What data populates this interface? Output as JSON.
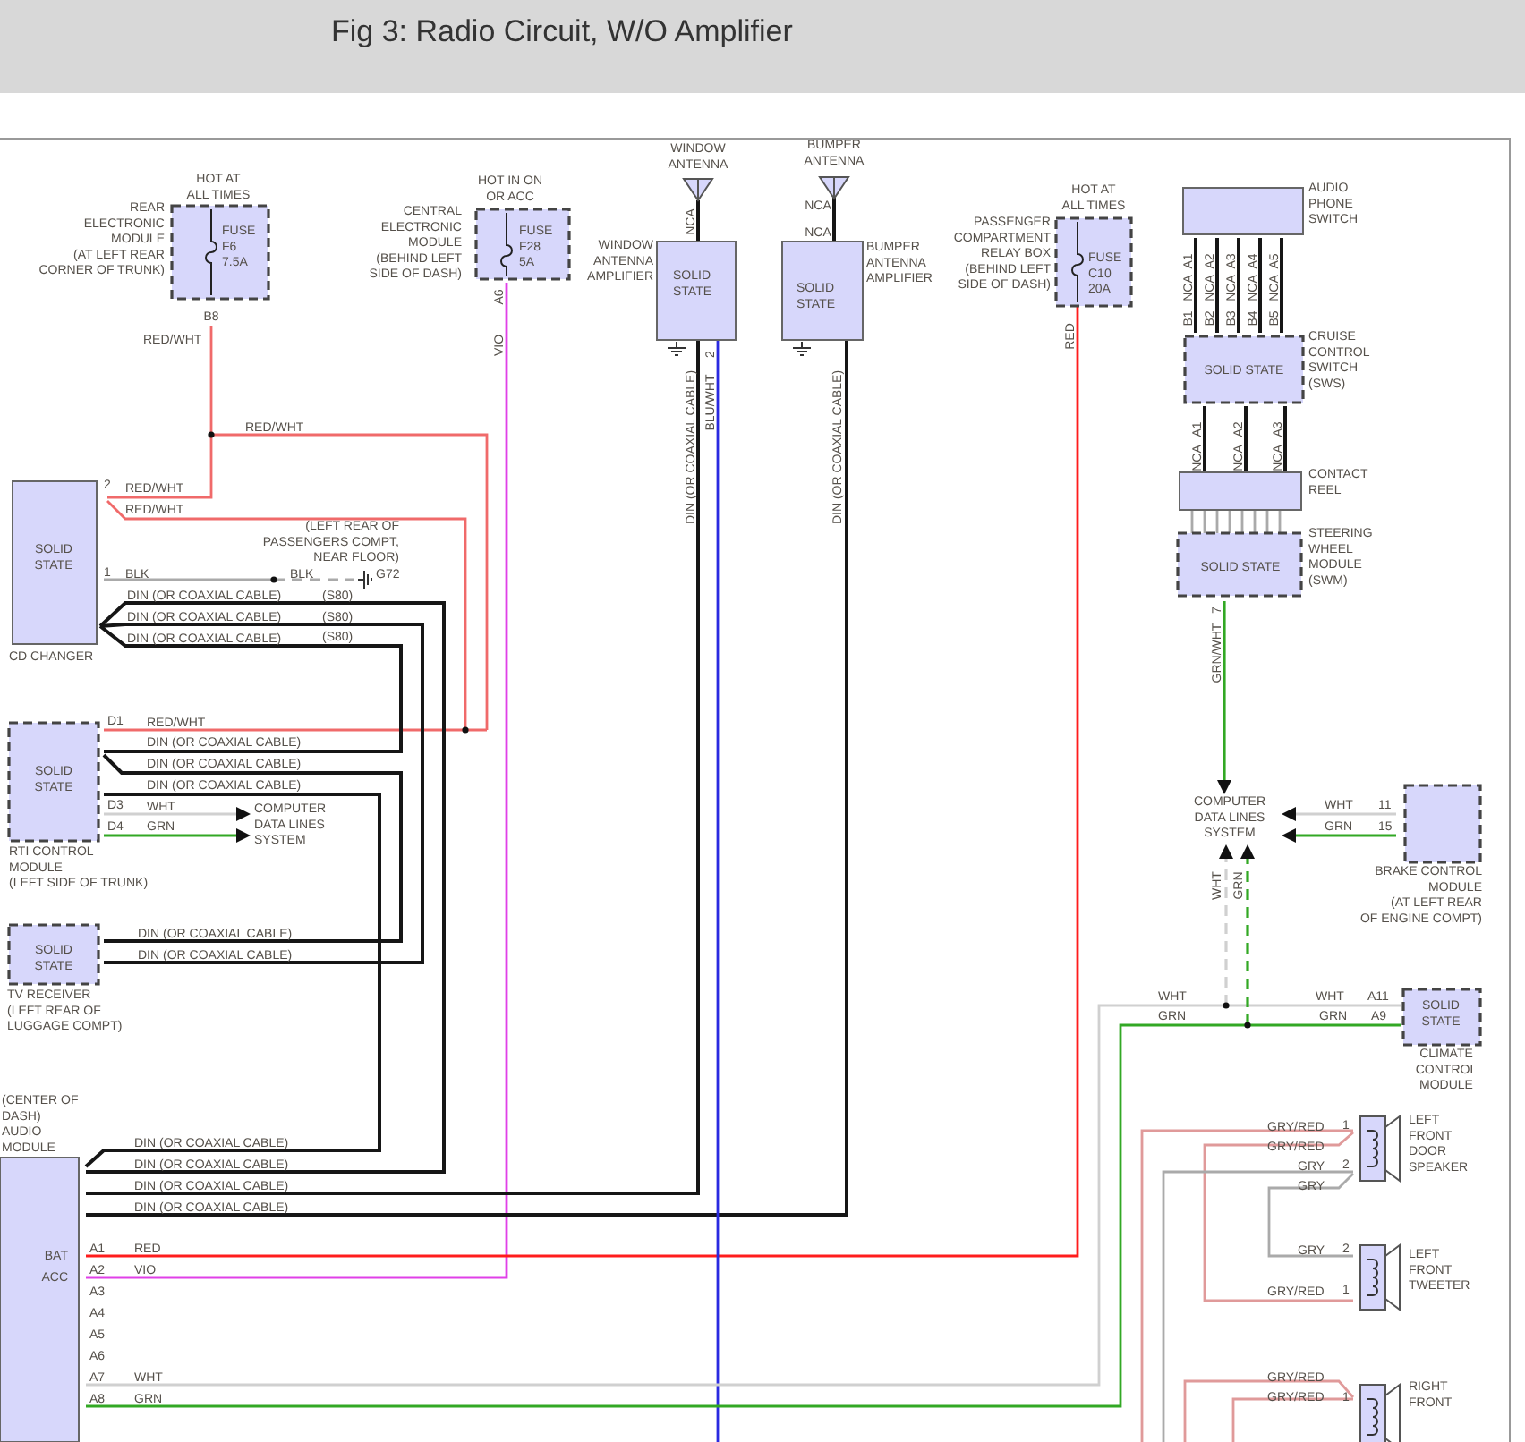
{
  "title": "Fig 3: Radio Circuit, W/O Amplifier",
  "diagram": {
    "modules": [
      {
        "kind": "fuse",
        "inner": [
          "FUSE",
          "F6",
          "7.5A"
        ],
        "caption": [
          "REAR",
          "ELECTRONIC",
          "MODULE",
          "(AT LEFT REAR",
          "CORNER OF TRUNK)"
        ]
      },
      {
        "kind": "fuse",
        "inner": [
          "FUSE",
          "F28",
          "5A"
        ],
        "caption": [
          "CENTRAL",
          "ELECTRONIC",
          "MODULE",
          "(BEHIND LEFT",
          "SIDE OF DASH)"
        ]
      },
      {
        "kind": "solid",
        "inner": [
          "SOLID",
          "STATE"
        ],
        "caption": [
          "WINDOW",
          "ANTENNA",
          "AMPLIFIER"
        ]
      },
      {
        "kind": "solid",
        "inner": [
          "SOLID",
          "STATE"
        ],
        "caption": [
          "BUMPER",
          "ANTENNA",
          "AMPLIFIER"
        ]
      },
      {
        "kind": "fuse",
        "inner": [
          "FUSE",
          "C10",
          "20A"
        ],
        "caption": [
          "PASSENGER",
          "COMPARTMENT",
          "RELAY BOX",
          "(BEHIND LEFT",
          "SIDE OF DASH)"
        ]
      },
      {
        "kind": "solid",
        "caption": [
          "AUDIO",
          "PHONE",
          "SWITCH"
        ]
      },
      {
        "kind": "dashed",
        "inner": [
          "SOLID STATE"
        ],
        "caption": [
          "CRUISE",
          "CONTROL",
          "SWITCH",
          "(SWS)"
        ]
      },
      {
        "kind": "solid",
        "caption": [
          "CONTACT",
          "REEL"
        ]
      },
      {
        "kind": "dashed",
        "inner": [
          "SOLID STATE"
        ],
        "caption": [
          "STEERING",
          "WHEEL",
          "MODULE",
          "(SWM)"
        ]
      },
      {
        "kind": "solid",
        "inner": [
          "SOLID",
          "STATE"
        ],
        "caption": [
          "CD CHANGER"
        ]
      },
      {
        "kind": "dashed",
        "inner": [
          "SOLID",
          "STATE"
        ],
        "caption": [
          "RTI CONTROL",
          "MODULE",
          "(LEFT SIDE OF TRUNK)"
        ]
      },
      {
        "kind": "dashed",
        "inner": [
          "SOLID",
          "STATE"
        ],
        "caption": [
          "TV RECEIVER",
          "(LEFT REAR OF",
          "LUGGAGE COMPT)"
        ]
      },
      {
        "kind": "dashed",
        "caption": [
          "BRAKE CONTROL",
          "MODULE",
          "(AT LEFT REAR",
          "OF ENGINE COMPT)"
        ]
      },
      {
        "kind": "dashed",
        "inner": [
          "SOLID",
          "STATE"
        ],
        "caption": [
          "CLIMATE",
          "CONTROL",
          "MODULE"
        ]
      },
      {
        "kind": "solid",
        "inner": [
          "BAT",
          "ACC"
        ],
        "caption": [
          "(CENTER OF",
          "DASH)",
          "AUDIO",
          "MODULE"
        ]
      },
      {
        "kind": "speaker",
        "caption": [
          "LEFT",
          "FRONT",
          "DOOR",
          "SPEAKER"
        ]
      },
      {
        "kind": "speaker",
        "caption": [
          "LEFT",
          "FRONT",
          "TWEETER"
        ]
      },
      {
        "kind": "speaker",
        "caption": [
          "RIGHT",
          "FRONT"
        ]
      },
      {
        "kind": "antenna",
        "caption": [
          "WINDOW",
          "ANTENNA"
        ]
      },
      {
        "kind": "antenna",
        "caption": [
          "BUMPER",
          "ANTENNA"
        ]
      },
      {
        "kind": "system",
        "caption": [
          "COMPUTER",
          "DATA LINES",
          "SYSTEM"
        ]
      },
      {
        "kind": "system",
        "caption": [
          "COMPUTER",
          "DATA LINES",
          "SYSTEM"
        ]
      },
      {
        "kind": "ground",
        "caption": [
          "G72"
        ]
      }
    ],
    "notes": [
      [
        "HOT AT",
        "ALL TIMES"
      ],
      [
        "HOT IN ON",
        "OR ACC"
      ],
      [
        "HOT AT",
        "ALL TIMES"
      ],
      [
        "(LEFT REAR OF",
        "PASSENGERS COMPT,",
        "NEAR FLOOR)"
      ]
    ],
    "wire_labels": [
      "RED/WHT",
      "RED/WHT",
      "RED/WHT",
      "RED/WHT",
      "BLK",
      "BLK",
      "DIN (OR COAXIAL CABLE)",
      "DIN (OR COAXIAL CABLE)",
      "DIN (OR COAXIAL CABLE)",
      "(S80)",
      "(S80)",
      "(S80)",
      "RED/WHT",
      "DIN (OR COAXIAL CABLE)",
      "DIN (OR COAXIAL CABLE)",
      "DIN (OR COAXIAL CABLE)",
      "WHT",
      "GRN",
      "DIN (OR COAXIAL CABLE)",
      "DIN (OR COAXIAL CABLE)",
      "DIN (OR COAXIAL CABLE)",
      "DIN (OR COAXIAL CABLE)",
      "DIN (OR COAXIAL CABLE)",
      "DIN (OR COAXIAL CABLE)",
      "RED",
      "VIO",
      "WHT",
      "GRN",
      "VIO",
      "DIN (OR COAXIAL CABLE)",
      "BLU/WHT",
      "DIN (OR COAXIAL CABLE)",
      "RED",
      "NCA",
      "NCA",
      "NCA",
      "NCA",
      "NCA",
      "NCA",
      "NCA",
      "NCA",
      "NCA",
      "NCA",
      "NCA",
      "GRN/WHT",
      "WHT",
      "GRN",
      "WHT",
      "GRN",
      "WHT",
      "GRN",
      "WHT",
      "GRN",
      "GRY/RED",
      "GRY/RED",
      "GRY",
      "GRY",
      "GRY",
      "GRY/RED",
      "GRY/RED",
      "GRY/RED"
    ],
    "pin_labels": [
      "B8",
      "A6",
      "2",
      "2",
      "1",
      "D1",
      "D3",
      "D4",
      "A1",
      "A2",
      "A3",
      "A4",
      "A5",
      "B1",
      "B2",
      "B3",
      "B4",
      "B5",
      "A1",
      "A2",
      "A3",
      "7",
      "11",
      "15",
      "A11",
      "A9",
      "A1",
      "A2",
      "A3",
      "A4",
      "A5",
      "A6",
      "A7",
      "A8",
      "1",
      "2",
      "2",
      "1",
      "1"
    ]
  }
}
